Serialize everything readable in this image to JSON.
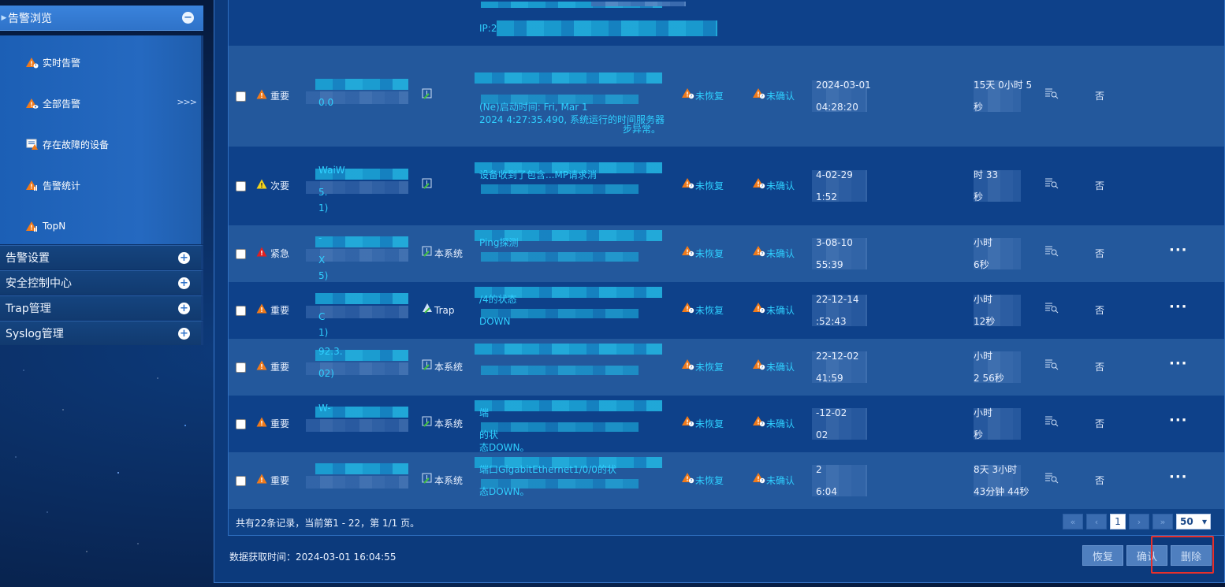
{
  "sidebar": {
    "header": {
      "label": "告警浏览",
      "toggle": "−"
    },
    "items": [
      {
        "label": "实时告警",
        "icon": "alarm-clock-icon"
      },
      {
        "label": "全部告警",
        "icon": "alarm-eye-icon",
        "more": ">>>"
      },
      {
        "label": "存在故障的设备",
        "icon": "faulty-device-icon"
      },
      {
        "label": "告警统计",
        "icon": "alarm-chart-icon"
      },
      {
        "label": "TopN",
        "icon": "alarm-chart-icon"
      }
    ],
    "groups": [
      {
        "label": "告警设置",
        "toggle": "+"
      },
      {
        "label": "安全控制中心",
        "toggle": "+"
      },
      {
        "label": "Trap管理",
        "toggle": "+"
      },
      {
        "label": "Syslog管理",
        "toggle": "+"
      }
    ]
  },
  "table": {
    "top_partial": {
      "desc": "IP:2"
    },
    "rows": [
      {
        "severity": "重要",
        "severity_color": "#f07a1a",
        "device": [
          "",
          "0.0"
        ],
        "source": "",
        "desc": [
          "",
          "(Ne)启动时间: Fri, Mar 1",
          "2024 4:27:35.490, 系统运行的时间服务器",
          "步异常。"
        ],
        "recover": "未恢复",
        "confirm": "未确认",
        "date": [
          "2024-03-01",
          "04:28:20"
        ],
        "duration": [
          "15天 0小时 5",
          "秒"
        ],
        "ack": "否",
        "dots": ""
      },
      {
        "severity": "次要",
        "severity_color": "#f2d21a",
        "device": [
          "WaiW",
          "5.",
          "1)"
        ],
        "source": "",
        "desc": [
          "设备收到了包含...MP请求消",
          ""
        ],
        "recover": "未恢复",
        "confirm": "未确认",
        "date": [
          "4-02-29",
          "1:52"
        ],
        "duration": [
          "时 33",
          "秒"
        ],
        "ack": "否",
        "dots": ""
      },
      {
        "severity": "紧急",
        "severity_color": "#e02020",
        "device": [
          "-",
          "X",
          "5)"
        ],
        "source": "本系统",
        "desc": [
          "Ping探测"
        ],
        "recover": "未恢复",
        "confirm": "未确认",
        "date": [
          "3-08-10",
          "55:39"
        ],
        "duration": [
          "小时",
          "6秒"
        ],
        "ack": "否",
        "dots": "···"
      },
      {
        "severity": "重要",
        "severity_color": "#f07a1a",
        "device": [
          "",
          "C",
          "1)"
        ],
        "source": "Trap",
        "desc": [
          "/4的状态",
          "DOWN"
        ],
        "recover": "未恢复",
        "confirm": "未确认",
        "date": [
          "22-12-14",
          ":52:43"
        ],
        "duration": [
          "小时",
          "12秒"
        ],
        "ack": "否",
        "dots": "···"
      },
      {
        "severity": "重要",
        "severity_color": "#f07a1a",
        "device": [
          "92.3.",
          "02)"
        ],
        "source": "本系统",
        "desc": [
          "",
          ""
        ],
        "recover": "未恢复",
        "confirm": "未确认",
        "date": [
          "22-12-02",
          "41:59"
        ],
        "duration": [
          "小时",
          "2 56秒"
        ],
        "ack": "否",
        "dots": "···"
      },
      {
        "severity": "重要",
        "severity_color": "#f07a1a",
        "device": [
          "W-",
          ""
        ],
        "source": "本系统",
        "desc": [
          "端",
          "的状",
          "态DOWN。"
        ],
        "recover": "未恢复",
        "confirm": "未确认",
        "date": [
          "-12-02",
          "02"
        ],
        "duration": [
          "小时",
          "秒"
        ],
        "ack": "否",
        "dots": "···"
      },
      {
        "severity": "重要",
        "severity_color": "#f07a1a",
        "device": [
          "",
          ""
        ],
        "source": "本系统",
        "desc": [
          "端口GigabitEthernet1/0/0的状",
          "态DOWN。"
        ],
        "recover": "未恢复",
        "confirm": "未确认",
        "date": [
          "2",
          "6:04"
        ],
        "duration": [
          "8天 3小时",
          "43分钟 44秒"
        ],
        "ack": "否",
        "dots": "···"
      }
    ]
  },
  "footer": {
    "records": "共有22条记录，当前第1 - 22，第 1/1 页。",
    "pager": {
      "first": "«",
      "prev": "‹",
      "page": "1",
      "next": "›",
      "last": "»",
      "page_size": "50"
    },
    "fetch_time": "数据获取时间：2024-03-01 16:04:55",
    "buttons": {
      "recover": "恢复",
      "confirm": "确认",
      "delete": "删除"
    }
  },
  "colors": {
    "accent": "#2fd0ff",
    "highlight": "#e8302b",
    "important": "#f07a1a",
    "minor": "#f2d21a",
    "urgent": "#e02020"
  }
}
